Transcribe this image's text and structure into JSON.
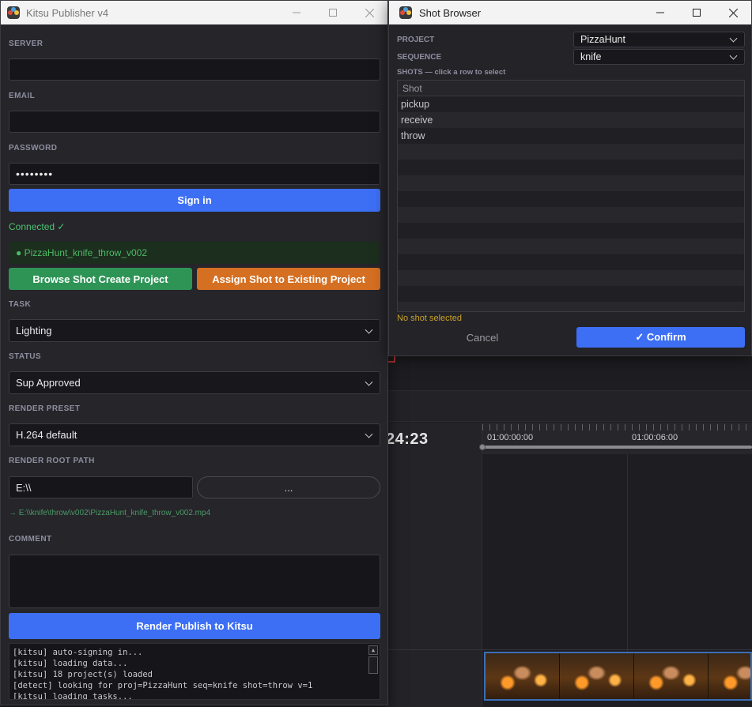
{
  "kitsu_window": {
    "title": "Kitsu Publisher v4",
    "server_label": "SERVER",
    "server_value": "",
    "email_label": "EMAIL",
    "email_value": "",
    "password_label": "PASSWORD",
    "password_value": "••••••••",
    "sign_in_label": "Sign in",
    "connected_status": "Connected ✓",
    "selected_shot": "● PizzaHunt_knife_throw_v002",
    "browse_button_label": "Browse Shot  Create Project",
    "assign_button_label": "Assign Shot to Existing Project",
    "task_label": "TASK",
    "task_value": "Lighting",
    "status_label": "STATUS",
    "status_value": "Sup Approved",
    "render_preset_label": "RENDER PRESET",
    "render_preset_value": "H.264 default",
    "render_root_label": "RENDER ROOT PATH",
    "render_root_value": "E:\\\\",
    "browse_path_label": "...",
    "output_path": "→ E:\\\\knife\\throw\\v002\\PizzaHunt_knife_throw_v002.mp4",
    "comment_label": "COMMENT",
    "comment_value": "",
    "render_publish_label": "Render  Publish to Kitsu",
    "log_lines": [
      "[kitsu] auto-signing in...",
      "[kitsu] loading data...",
      "[kitsu] 18 project(s) loaded",
      "[detect] looking for proj=PizzaHunt seq=knife shot=throw v=1",
      "[kitsu] loading tasks..."
    ]
  },
  "shot_browser": {
    "title": "Shot Browser",
    "project_label": "PROJECT",
    "project_value": "PizzaHunt",
    "sequence_label": "SEQUENCE",
    "sequence_value": "knife",
    "shots_label": "SHOTS — click a row to select",
    "table_header": "Shot",
    "shots": [
      "pickup",
      "receive",
      "throw"
    ],
    "selection_status": "No shot selected",
    "cancel_label": "Cancel",
    "confirm_label": "✓  Confirm"
  },
  "editor_background": {
    "timecode": "24:23",
    "ruler_labels": [
      "01:00:00:00",
      "01:00:06:00"
    ]
  },
  "colors": {
    "accent_blue": "#3d6ff5",
    "green_button": "#2e9456",
    "orange_button": "#d56f22",
    "connected_green": "#4cc46e",
    "warning_yellow": "#c9a227"
  }
}
